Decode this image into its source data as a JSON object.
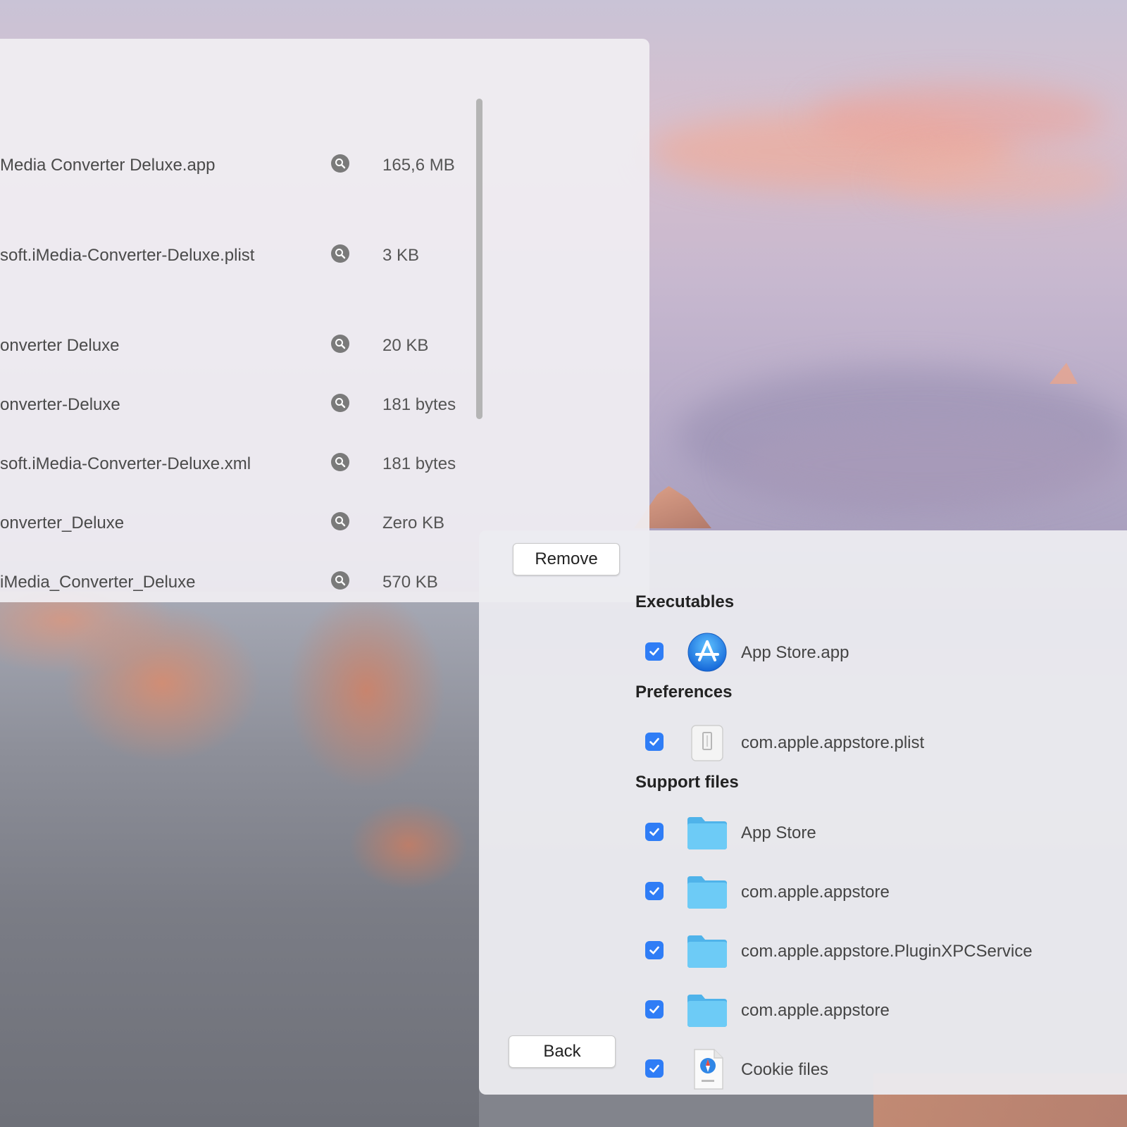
{
  "left_panel": {
    "files": [
      {
        "name": "Media Converter Deluxe.app",
        "size": "165,6 MB"
      },
      {
        "name": "soft.iMedia-Converter-Deluxe.plist",
        "size": "3 KB"
      },
      {
        "name": "onverter Deluxe",
        "size": "20 KB"
      },
      {
        "name": "onverter-Deluxe",
        "size": "181 bytes"
      },
      {
        "name": "soft.iMedia-Converter-Deluxe.xml",
        "size": "181 bytes"
      },
      {
        "name": "onverter_Deluxe",
        "size": "Zero KB"
      },
      {
        "name": "iMedia_Converter_Deluxe",
        "size": "570 KB"
      }
    ],
    "remove_label": "Remove"
  },
  "right_panel": {
    "back_label": "Back",
    "sections": {
      "executables": {
        "title": "Executables",
        "items": [
          {
            "label": "App Store.app",
            "icon": "app-store-icon",
            "checked": true
          }
        ]
      },
      "preferences": {
        "title": "Preferences",
        "items": [
          {
            "label": "com.apple.appstore.plist",
            "icon": "plist-file-icon",
            "checked": true
          }
        ]
      },
      "support_files": {
        "title": "Support files",
        "items": [
          {
            "label": "App Store",
            "icon": "folder-icon",
            "checked": true
          },
          {
            "label": "com.apple.appstore",
            "icon": "folder-icon",
            "checked": true
          },
          {
            "label": "com.apple.appstore.PluginXPCService",
            "icon": "folder-icon",
            "checked": true
          },
          {
            "label": "com.apple.appstore",
            "icon": "folder-icon",
            "checked": true
          },
          {
            "label": "Cookie files",
            "icon": "cookie-file-icon",
            "checked": true
          }
        ]
      }
    }
  },
  "colors": {
    "checkbox_blue": "#2f7df6",
    "folder_blue": "#5ec3f2",
    "panel_bg": "#efeef1"
  }
}
